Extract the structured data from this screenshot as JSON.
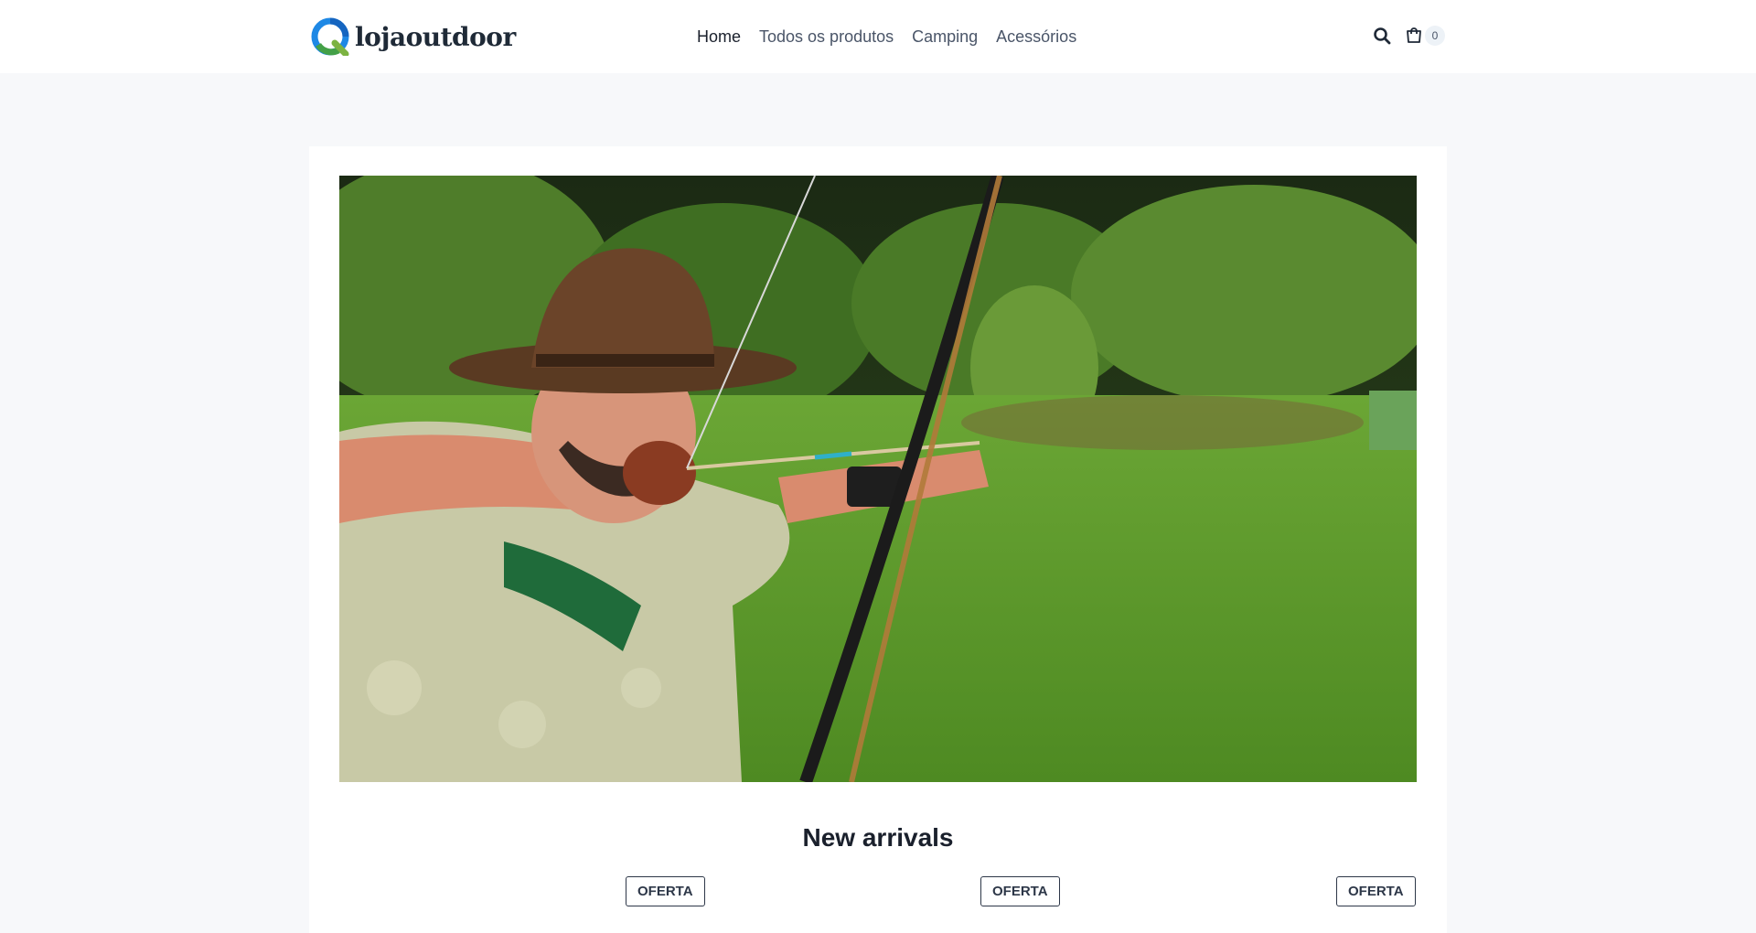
{
  "brand": {
    "name": "lojaoutdoor",
    "logo_icon": "lojaoutdoor-logo-icon"
  },
  "nav": {
    "items": [
      {
        "label": "Home",
        "active": true
      },
      {
        "label": "Todos os produtos",
        "active": false
      },
      {
        "label": "Camping",
        "active": false
      },
      {
        "label": "Acessórios",
        "active": false
      }
    ]
  },
  "header_actions": {
    "search_icon": "search-icon",
    "cart_icon": "cart-icon",
    "cart_count": "0"
  },
  "hero": {
    "image": "archer-drawing-bow-in-field"
  },
  "new_arrivals": {
    "title": "New arrivals",
    "badges": [
      "OFERTA",
      "OFERTA",
      "OFERTA"
    ]
  },
  "colors": {
    "accent": "#2b6cb0",
    "text": "#1a202c",
    "page_bg": "#f7f8fa"
  }
}
